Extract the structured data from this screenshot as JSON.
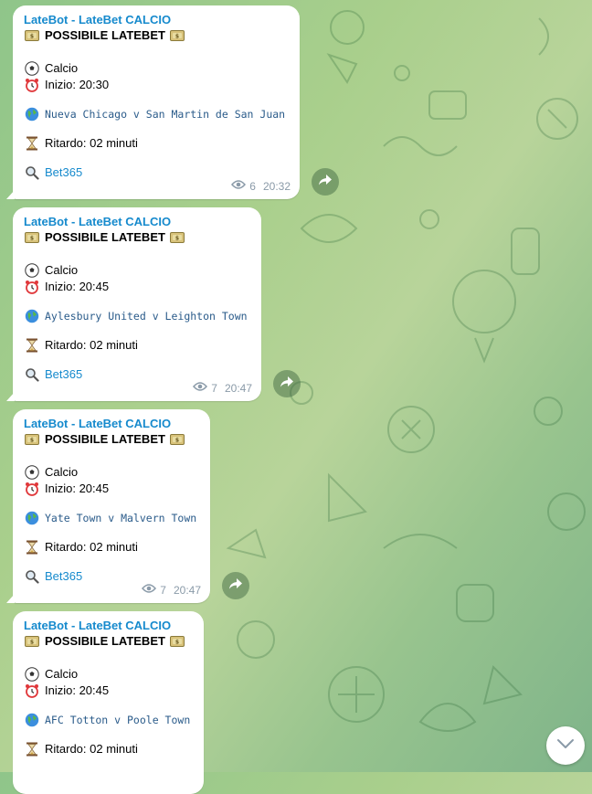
{
  "messages": [
    {
      "sender": "LateBot - LateBet CALCIO",
      "headline": "POSSIBILE LATEBET",
      "sport": "Calcio",
      "start": "Inizio: 20:30",
      "match": "Nueva Chicago v San Martin de San Juan",
      "delay": "Ritardo: 02 minuti",
      "bookmaker": "Bet365",
      "views": "6",
      "time": "20:32"
    },
    {
      "sender": "LateBot - LateBet CALCIO",
      "headline": "POSSIBILE LATEBET",
      "sport": "Calcio",
      "start": "Inizio: 20:45",
      "match": "Aylesbury United v Leighton Town",
      "delay": "Ritardo: 02 minuti",
      "bookmaker": "Bet365",
      "views": "7",
      "time": "20:47"
    },
    {
      "sender": "LateBot - LateBet CALCIO",
      "headline": "POSSIBILE LATEBET",
      "sport": "Calcio",
      "start": "Inizio: 20:45",
      "match": "Yate Town v Malvern Town",
      "delay": "Ritardo: 02 minuti",
      "bookmaker": "Bet365",
      "views": "7",
      "time": "20:47"
    },
    {
      "sender": "LateBot - LateBet CALCIO",
      "headline": "POSSIBILE LATEBET",
      "sport": "Calcio",
      "start": "Inizio: 20:45",
      "match": "AFC Totton v Poole Town",
      "delay": "Ritardo: 02 minuti"
    }
  ],
  "icons": {
    "money": "money-bag-icon",
    "ball": "soccer-ball-icon",
    "alarm": "alarm-clock-icon",
    "globe": "globe-icon",
    "hourglass": "hourglass-icon",
    "search": "magnifier-icon",
    "views": "eye-icon",
    "share": "share-arrow-icon",
    "scroll": "chevron-down-icon"
  },
  "colors": {
    "sender": "#168acd",
    "link": "#168acd",
    "meta": "#8a9aa8",
    "bubble": "#ffffff"
  }
}
